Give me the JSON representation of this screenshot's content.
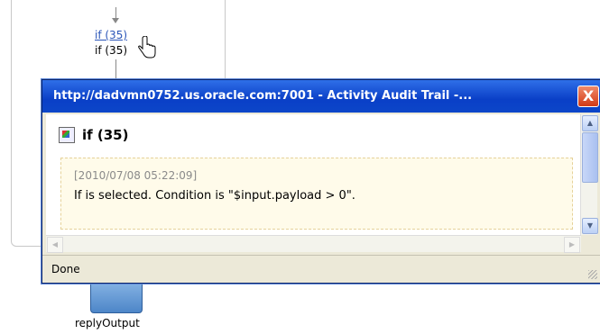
{
  "background": {
    "link_label": "if (35)",
    "node_label": "if (35)",
    "reply_label": "replyOutput"
  },
  "popup": {
    "title": "http://dadvmn0752.us.oracle.com:7001 - Activity Audit Trail -...",
    "close_label": "X",
    "heading": "if (35)",
    "entry": {
      "timestamp": "[2010/07/08 05:22:09]",
      "message": "If is selected. Condition is \"$input.payload > 0\"."
    },
    "status": "Done"
  },
  "icons": {
    "close": "close-icon",
    "heading": "activity-icon",
    "cursor": "hand-cursor-icon"
  },
  "colors": {
    "titlebar": "#0a3fc7",
    "close": "#d23a16",
    "link": "#2a55b8"
  }
}
